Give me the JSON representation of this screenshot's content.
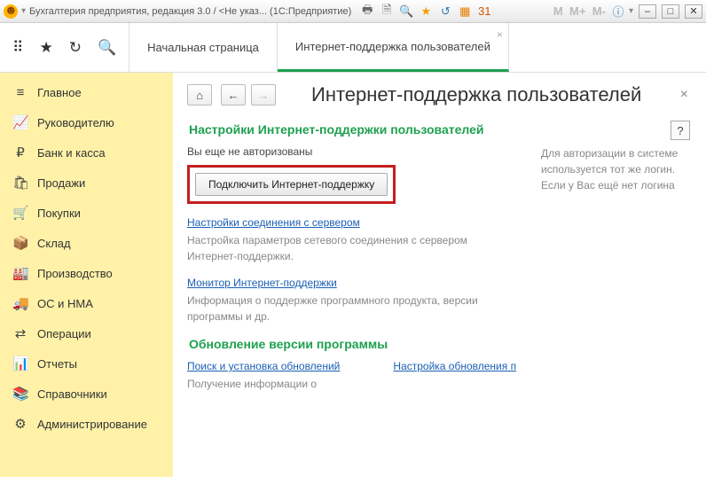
{
  "titlebar": {
    "title": "Бухгалтерия предприятия, редакция 3.0 / <Не указ...  (1С:Предприятие)"
  },
  "toolbar": {
    "tabs": [
      {
        "label": "Начальная страница"
      },
      {
        "label": "Интернет-поддержка пользователей"
      }
    ]
  },
  "sidebar": {
    "items": [
      {
        "icon": "≡",
        "label": "Главное"
      },
      {
        "icon": "📈",
        "label": "Руководителю"
      },
      {
        "icon": "₽",
        "label": "Банк и касса"
      },
      {
        "icon": "🛍",
        "label": "Продажи"
      },
      {
        "icon": "🛒",
        "label": "Покупки"
      },
      {
        "icon": "📦",
        "label": "Склад"
      },
      {
        "icon": "🏭",
        "label": "Производство"
      },
      {
        "icon": "🚚",
        "label": "ОС и НМА"
      },
      {
        "icon": "⇄",
        "label": "Операции"
      },
      {
        "icon": "📊",
        "label": "Отчеты"
      },
      {
        "icon": "📚",
        "label": "Справочники"
      },
      {
        "icon": "⚙",
        "label": "Администрирование"
      }
    ]
  },
  "content": {
    "page_title": "Интернет-поддержка пользователей",
    "help": "?",
    "section1_title": "Настройки Интернет-поддержки пользователей",
    "not_authorized": "Вы еще не авторизованы",
    "connect_button": "Подключить Интернет-поддержку",
    "right_info": "Для авторизации в системе используется тот же логин. Если у Вас ещё нет логина",
    "link_conn": "Настройки соединения с сервером",
    "desc_conn": "Настройка параметров сетевого соединения с сервером Интернет-поддержки.",
    "link_monitor": "Монитор Интернет-поддержки",
    "desc_monitor": "Информация о поддержке программного продукта, версии программы и др.",
    "section2_title": "Обновление версии программы",
    "link_update": "Поиск и установка обновлений",
    "link_update_right": "Настройка обновления п",
    "desc_update": "Получение информации о"
  }
}
